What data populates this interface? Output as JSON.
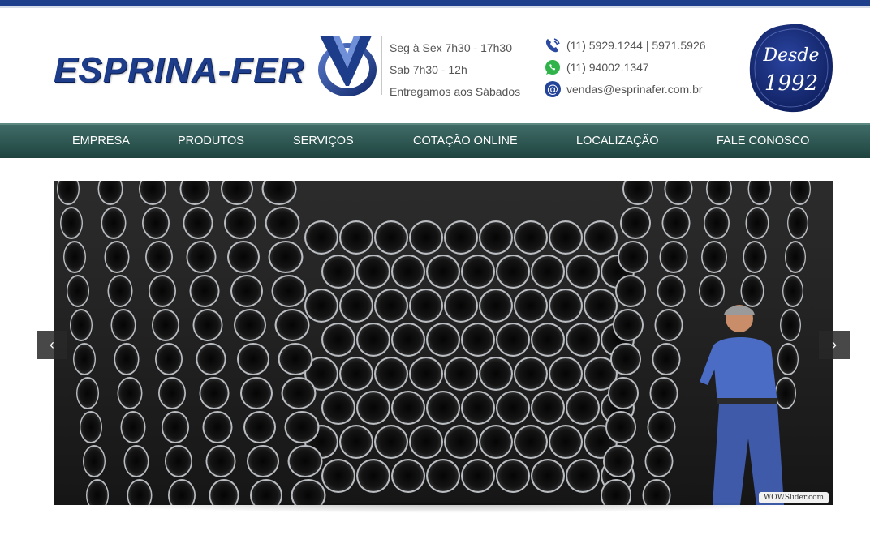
{
  "header": {
    "logo_text": "ESPRINA-FER",
    "hours": [
      "Seg à Sex 7h30 - 17h30",
      "Sab 7h30 - 12h",
      "Entregamos aos Sábados"
    ],
    "phone": "(11) 5929.1244 | 5971.5926",
    "whatsapp": "(11) 94002.1347",
    "email": "vendas@esprinafer.com.br",
    "seal_line1": "Desde",
    "seal_line2": "1992",
    "icons": {
      "phone": "phone-icon",
      "whatsapp": "whatsapp-icon",
      "email": "email-at-icon"
    }
  },
  "nav": {
    "items": [
      "EMPRESA",
      "PRODUTOS",
      "SERVIÇOS",
      "COTAÇÃO ONLINE",
      "LOCALIZAÇÃO",
      "FALE CONOSCO"
    ]
  },
  "slider": {
    "prev_label": "‹",
    "next_label": "›",
    "credit": "WOWSlider.com"
  },
  "colors": {
    "brand_blue": "#1d3c8a",
    "nav_green": "#2f5651",
    "seal_blue": "#1a2f7a"
  }
}
